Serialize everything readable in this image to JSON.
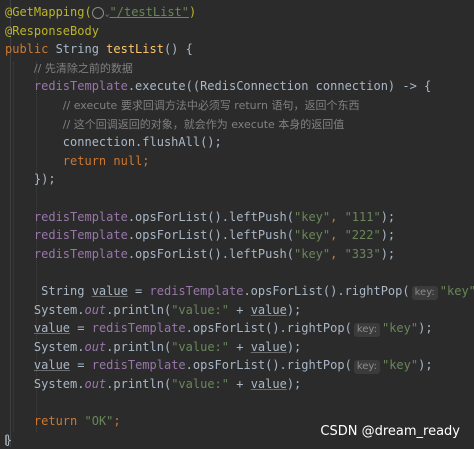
{
  "code": {
    "ann_get": "@GetMapping(",
    "ann_get_path": "\"/testList\"",
    "ann_close": ")",
    "ann_body": "@ResponseBody",
    "kw_public": "public",
    "type_string": " String ",
    "method_name": "testList",
    "method_sig_tail": "() {",
    "comment_clear": "// 先清除之前的数据",
    "redis_template": "redisTemplate",
    "execute_call": ".execute((RedisConnection connection) -> {",
    "comment_exec_1": "// execute 要求回调方法中必须写 return 语句，返回个东西",
    "comment_exec_2": "// 这个回调返回的对象，就会作为 execute 本身的返回值",
    "flush_call": "connection.flushAll();",
    "kw_return": "return",
    "kw_null": "null",
    "semicolon": ";",
    "close_lambda": "});",
    "push_prefix": ".opsForList().leftPush(",
    "key_literal": "\"key\"",
    "comma": ", ",
    "val_111": "\"111\"",
    "val_222": "\"222\"",
    "val_333": "\"333\"",
    "close_paren_semi": ");",
    "var_value": "value",
    "assign": " = ",
    "pop_call": ".opsForList().rightPop(",
    "hint_key": "key:",
    "system": "System.",
    "out": "out",
    "println": ".println(",
    "value_label": "\"value:\"",
    "plus": " + ",
    "return_ok": "\"OK\"",
    "close_brace": "}"
  },
  "watermark": "CSDN @dream_ready"
}
